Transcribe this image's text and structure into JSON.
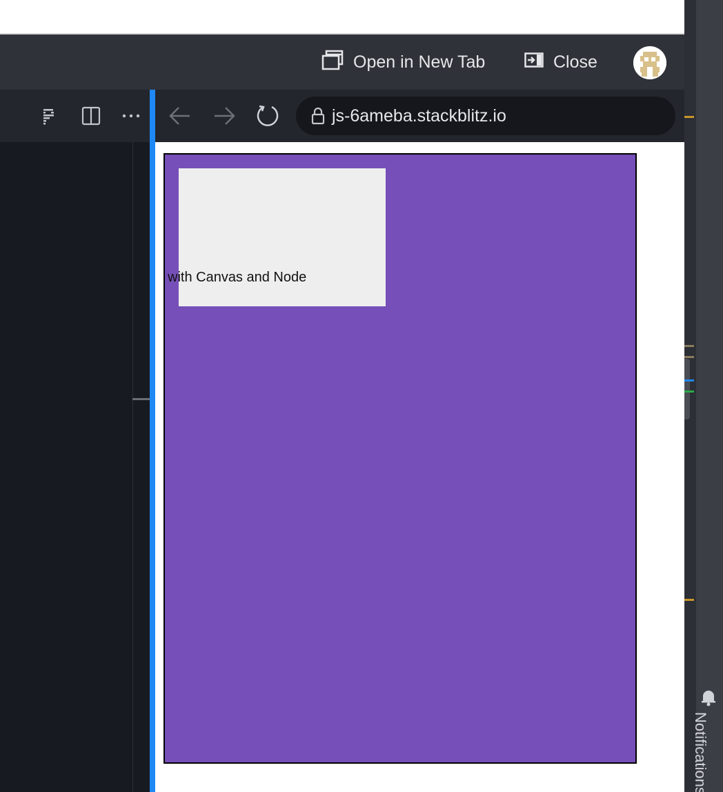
{
  "preview_header": {
    "open_in_new_tab_label": "Open in New Tab",
    "close_label": "Close"
  },
  "browser": {
    "url": "js-6ameba.stackblitz.io"
  },
  "preview": {
    "node_text": "with Canvas and Node"
  },
  "sidebar": {
    "notifications_label": "Notifications"
  },
  "colors": {
    "accent": "#1e88f5",
    "canvas_bg": "#7650b8",
    "node_bg": "#eeeeee",
    "header_bg": "#2f3238",
    "toolbar_bg": "#23262c",
    "editor_bg": "#171a20"
  },
  "icons": {
    "open_in_new_tab": "open-in-new-tab-icon",
    "close": "close-panel-icon",
    "prettier": "prettier-icon",
    "split_editor": "split-editor-icon",
    "more": "more-icon",
    "back": "back-arrow-icon",
    "forward": "forward-arrow-icon",
    "reload": "reload-icon",
    "lock": "lock-icon",
    "notifications": "bell-icon"
  }
}
